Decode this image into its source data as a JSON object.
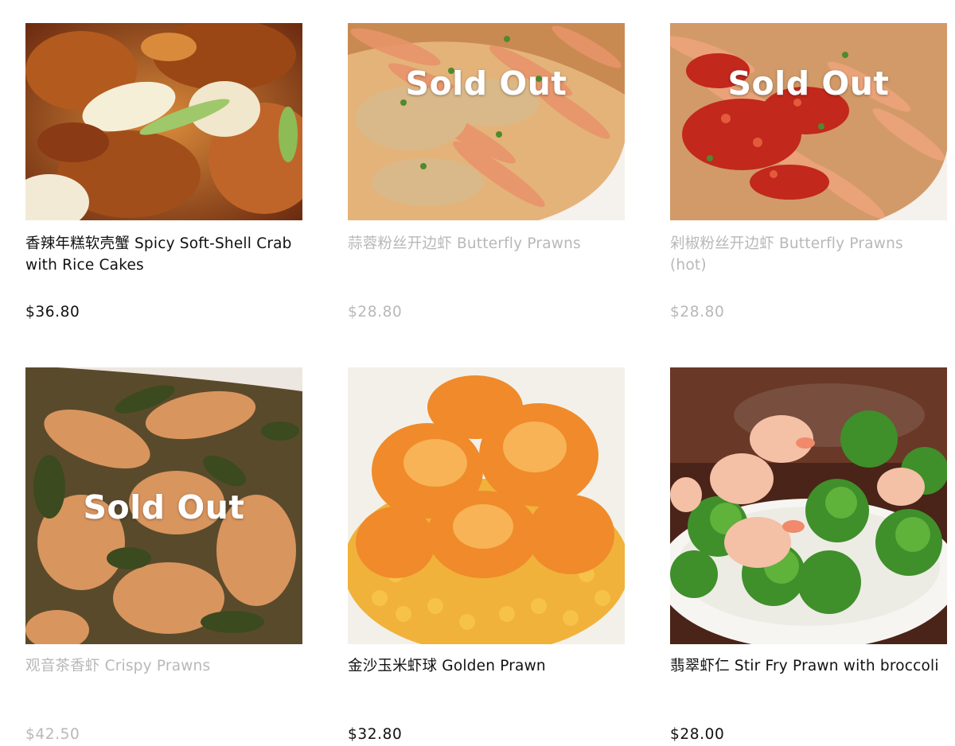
{
  "menu": {
    "items": [
      {
        "name": "香辣年糕软壳蟹 Spicy Soft-Shell Crab with Rice Cakes",
        "price": "$36.80",
        "sold_out": false,
        "sold_out_label": ""
      },
      {
        "name": "蒜蓉粉丝开边虾 Butterfly Prawns",
        "price": "$28.80",
        "sold_out": true,
        "sold_out_label": "Sold Out"
      },
      {
        "name": "剁椒粉丝开边虾 Butterfly Prawns (hot)",
        "price": "$28.80",
        "sold_out": true,
        "sold_out_label": "Sold Out"
      },
      {
        "name": "观音茶香虾 Crispy Prawns",
        "price": "$42.50",
        "sold_out": true,
        "sold_out_label": "Sold Out"
      },
      {
        "name": "金沙玉米虾球 Golden Prawn",
        "price": "$32.80",
        "sold_out": false,
        "sold_out_label": ""
      },
      {
        "name": "翡翠虾仁 Stir Fry Prawn with broccoli",
        "price": "$28.00",
        "sold_out": false,
        "sold_out_label": ""
      }
    ]
  },
  "colors": {
    "text": "#111111",
    "disabled_text": "#b8b8b8",
    "sold_out_label": "#ffffff"
  }
}
